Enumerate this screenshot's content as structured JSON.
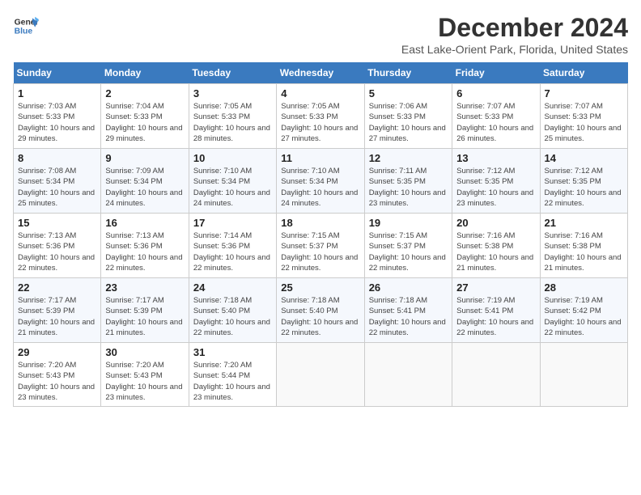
{
  "header": {
    "logo_line1": "General",
    "logo_line2": "Blue",
    "title": "December 2024",
    "subtitle": "East Lake-Orient Park, Florida, United States"
  },
  "days_of_week": [
    "Sunday",
    "Monday",
    "Tuesday",
    "Wednesday",
    "Thursday",
    "Friday",
    "Saturday"
  ],
  "weeks": [
    [
      {
        "day": "1",
        "sunrise": "7:03 AM",
        "sunset": "5:33 PM",
        "daylight": "10 hours and 29 minutes."
      },
      {
        "day": "2",
        "sunrise": "7:04 AM",
        "sunset": "5:33 PM",
        "daylight": "10 hours and 29 minutes."
      },
      {
        "day": "3",
        "sunrise": "7:05 AM",
        "sunset": "5:33 PM",
        "daylight": "10 hours and 28 minutes."
      },
      {
        "day": "4",
        "sunrise": "7:05 AM",
        "sunset": "5:33 PM",
        "daylight": "10 hours and 27 minutes."
      },
      {
        "day": "5",
        "sunrise": "7:06 AM",
        "sunset": "5:33 PM",
        "daylight": "10 hours and 27 minutes."
      },
      {
        "day": "6",
        "sunrise": "7:07 AM",
        "sunset": "5:33 PM",
        "daylight": "10 hours and 26 minutes."
      },
      {
        "day": "7",
        "sunrise": "7:07 AM",
        "sunset": "5:33 PM",
        "daylight": "10 hours and 25 minutes."
      }
    ],
    [
      {
        "day": "8",
        "sunrise": "7:08 AM",
        "sunset": "5:34 PM",
        "daylight": "10 hours and 25 minutes."
      },
      {
        "day": "9",
        "sunrise": "7:09 AM",
        "sunset": "5:34 PM",
        "daylight": "10 hours and 24 minutes."
      },
      {
        "day": "10",
        "sunrise": "7:10 AM",
        "sunset": "5:34 PM",
        "daylight": "10 hours and 24 minutes."
      },
      {
        "day": "11",
        "sunrise": "7:10 AM",
        "sunset": "5:34 PM",
        "daylight": "10 hours and 24 minutes."
      },
      {
        "day": "12",
        "sunrise": "7:11 AM",
        "sunset": "5:35 PM",
        "daylight": "10 hours and 23 minutes."
      },
      {
        "day": "13",
        "sunrise": "7:12 AM",
        "sunset": "5:35 PM",
        "daylight": "10 hours and 23 minutes."
      },
      {
        "day": "14",
        "sunrise": "7:12 AM",
        "sunset": "5:35 PM",
        "daylight": "10 hours and 22 minutes."
      }
    ],
    [
      {
        "day": "15",
        "sunrise": "7:13 AM",
        "sunset": "5:36 PM",
        "daylight": "10 hours and 22 minutes."
      },
      {
        "day": "16",
        "sunrise": "7:13 AM",
        "sunset": "5:36 PM",
        "daylight": "10 hours and 22 minutes."
      },
      {
        "day": "17",
        "sunrise": "7:14 AM",
        "sunset": "5:36 PM",
        "daylight": "10 hours and 22 minutes."
      },
      {
        "day": "18",
        "sunrise": "7:15 AM",
        "sunset": "5:37 PM",
        "daylight": "10 hours and 22 minutes."
      },
      {
        "day": "19",
        "sunrise": "7:15 AM",
        "sunset": "5:37 PM",
        "daylight": "10 hours and 22 minutes."
      },
      {
        "day": "20",
        "sunrise": "7:16 AM",
        "sunset": "5:38 PM",
        "daylight": "10 hours and 21 minutes."
      },
      {
        "day": "21",
        "sunrise": "7:16 AM",
        "sunset": "5:38 PM",
        "daylight": "10 hours and 21 minutes."
      }
    ],
    [
      {
        "day": "22",
        "sunrise": "7:17 AM",
        "sunset": "5:39 PM",
        "daylight": "10 hours and 21 minutes."
      },
      {
        "day": "23",
        "sunrise": "7:17 AM",
        "sunset": "5:39 PM",
        "daylight": "10 hours and 21 minutes."
      },
      {
        "day": "24",
        "sunrise": "7:18 AM",
        "sunset": "5:40 PM",
        "daylight": "10 hours and 22 minutes."
      },
      {
        "day": "25",
        "sunrise": "7:18 AM",
        "sunset": "5:40 PM",
        "daylight": "10 hours and 22 minutes."
      },
      {
        "day": "26",
        "sunrise": "7:18 AM",
        "sunset": "5:41 PM",
        "daylight": "10 hours and 22 minutes."
      },
      {
        "day": "27",
        "sunrise": "7:19 AM",
        "sunset": "5:41 PM",
        "daylight": "10 hours and 22 minutes."
      },
      {
        "day": "28",
        "sunrise": "7:19 AM",
        "sunset": "5:42 PM",
        "daylight": "10 hours and 22 minutes."
      }
    ],
    [
      {
        "day": "29",
        "sunrise": "7:20 AM",
        "sunset": "5:43 PM",
        "daylight": "10 hours and 23 minutes."
      },
      {
        "day": "30",
        "sunrise": "7:20 AM",
        "sunset": "5:43 PM",
        "daylight": "10 hours and 23 minutes."
      },
      {
        "day": "31",
        "sunrise": "7:20 AM",
        "sunset": "5:44 PM",
        "daylight": "10 hours and 23 minutes."
      },
      null,
      null,
      null,
      null
    ]
  ]
}
